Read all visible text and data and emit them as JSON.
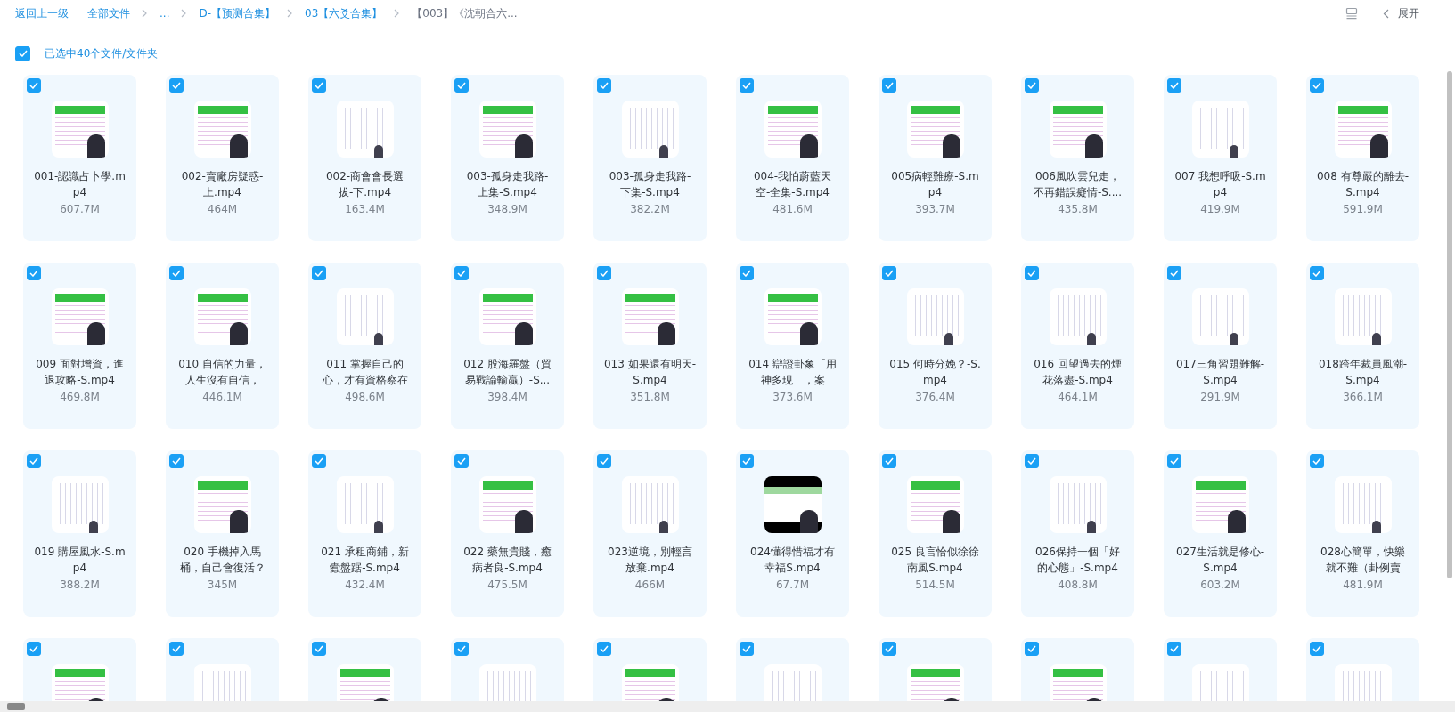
{
  "breadcrumb": {
    "back": "返回上一级",
    "items": [
      {
        "label": "全部文件",
        "current": false
      },
      {
        "label": "...",
        "current": false
      },
      {
        "label": "D-【预测合集】",
        "current": false
      },
      {
        "label": "03【六爻合集】",
        "current": false
      },
      {
        "label": "【003】《沈朝合六...",
        "current": true
      }
    ]
  },
  "toolbar": {
    "expand": "展开"
  },
  "selection": {
    "checked": true,
    "label": "已选中40个文件/文件夹"
  },
  "files": [
    {
      "name": [
        "001-認識占卜學.m",
        "p4"
      ],
      "size": "607.7M",
      "checked": true,
      "kind": "green"
    },
    {
      "name": [
        "002-賣廠房疑惑-",
        "上.mp4"
      ],
      "size": "464M",
      "checked": true,
      "kind": "green"
    },
    {
      "name": [
        "002-商會會長選",
        "拔-下.mp4"
      ],
      "size": "163.4M",
      "checked": true,
      "kind": "white"
    },
    {
      "name": [
        "003-孤身走我路-",
        "上集-S.mp4"
      ],
      "size": "348.9M",
      "checked": true,
      "kind": "green"
    },
    {
      "name": [
        "003-孤身走我路-",
        "下集-S.mp4"
      ],
      "size": "382.2M",
      "checked": true,
      "kind": "white"
    },
    {
      "name": [
        "004-我怕蔚藍天",
        "空-全集-S.mp4"
      ],
      "size": "481.6M",
      "checked": true,
      "kind": "green"
    },
    {
      "name": [
        "005病輕難療-S.m",
        "p4"
      ],
      "size": "393.7M",
      "checked": true,
      "kind": "green"
    },
    {
      "name": [
        "006風吹雲兒走，",
        "不再錯誤癡情-S...."
      ],
      "size": "435.8M",
      "checked": true,
      "kind": "green"
    },
    {
      "name": [
        "007 我想呼吸-S.m",
        "p4"
      ],
      "size": "419.9M",
      "checked": true,
      "kind": "white"
    },
    {
      "name": [
        "008 有尊嚴的離去-",
        "S.mp4"
      ],
      "size": "591.9M",
      "checked": true,
      "kind": "green"
    },
    {
      "name": [
        "009 面對增資，進",
        "退攻略-S.mp4"
      ],
      "size": "469.8M",
      "checked": true,
      "kind": "green"
    },
    {
      "name": [
        "010 自信的力量，",
        "人生沒有自信，"
      ],
      "size": "446.1M",
      "checked": true,
      "kind": "green"
    },
    {
      "name": [
        "011 掌握自己的",
        "心，才有資格察在"
      ],
      "size": "498.6M",
      "checked": true,
      "kind": "white"
    },
    {
      "name": [
        "012 股海羅盤（貿",
        "易戰論輸贏）-S..."
      ],
      "size": "398.4M",
      "checked": true,
      "kind": "green"
    },
    {
      "name": [
        "013 如果還有明天-",
        "S.mp4"
      ],
      "size": "351.8M",
      "checked": true,
      "kind": "green"
    },
    {
      "name": [
        "014 辯證卦象「用",
        "神多現」，案"
      ],
      "size": "373.6M",
      "checked": true,
      "kind": "green"
    },
    {
      "name": [
        "015 何時分娩？-S.",
        "mp4"
      ],
      "size": "376.4M",
      "checked": true,
      "kind": "white"
    },
    {
      "name": [
        "016 回望過去的煙",
        "花落盡-S.mp4"
      ],
      "size": "464.1M",
      "checked": true,
      "kind": "white"
    },
    {
      "name": [
        "017三角習題難解-",
        "S.mp4"
      ],
      "size": "291.9M",
      "checked": true,
      "kind": "white"
    },
    {
      "name": [
        "018跨年裁員風潮-",
        "S.mp4"
      ],
      "size": "366.1M",
      "checked": true,
      "kind": "white"
    },
    {
      "name": [
        "019 購屋風水-S.m",
        "p4"
      ],
      "size": "388.2M",
      "checked": true,
      "kind": "white"
    },
    {
      "name": [
        "020 手機掉入馬",
        "桶，自己會復活？"
      ],
      "size": "345M",
      "checked": true,
      "kind": "green"
    },
    {
      "name": [
        "021 承租商鋪，新",
        "蠹盤踞-S.mp4"
      ],
      "size": "432.4M",
      "checked": true,
      "kind": "white"
    },
    {
      "name": [
        "022 藥無貴賤，癒",
        "病者良-S.mp4"
      ],
      "size": "475.5M",
      "checked": true,
      "kind": "green"
    },
    {
      "name": [
        "023逆境，別輕言",
        "放棄.mp4"
      ],
      "size": "466M",
      "checked": true,
      "kind": "white"
    },
    {
      "name": [
        "024懂得惜福才有",
        "幸福S.mp4"
      ],
      "size": "67.7M",
      "checked": true,
      "kind": "dark"
    },
    {
      "name": [
        "025 良言恰似徐徐",
        "南風S.mp4"
      ],
      "size": "514.5M",
      "checked": true,
      "kind": "green"
    },
    {
      "name": [
        "026保持一個「好",
        "的心態」-S.mp4"
      ],
      "size": "408.8M",
      "checked": true,
      "kind": "white"
    },
    {
      "name": [
        "027生活就是修心-",
        "S.mp4"
      ],
      "size": "603.2M",
      "checked": true,
      "kind": "green"
    },
    {
      "name": [
        "028心簡單，快樂",
        "就不難（卦例賣"
      ],
      "size": "481.9M",
      "checked": true,
      "kind": "white"
    },
    {
      "checked": true,
      "kind": "green"
    },
    {
      "checked": true,
      "kind": "white"
    },
    {
      "checked": true,
      "kind": "green"
    },
    {
      "checked": true,
      "kind": "white"
    },
    {
      "checked": true,
      "kind": "green"
    },
    {
      "checked": true,
      "kind": "white"
    },
    {
      "checked": true,
      "kind": "green"
    },
    {
      "checked": true,
      "kind": "green"
    },
    {
      "checked": true,
      "kind": "white"
    },
    {
      "checked": true,
      "kind": "white"
    }
  ]
}
